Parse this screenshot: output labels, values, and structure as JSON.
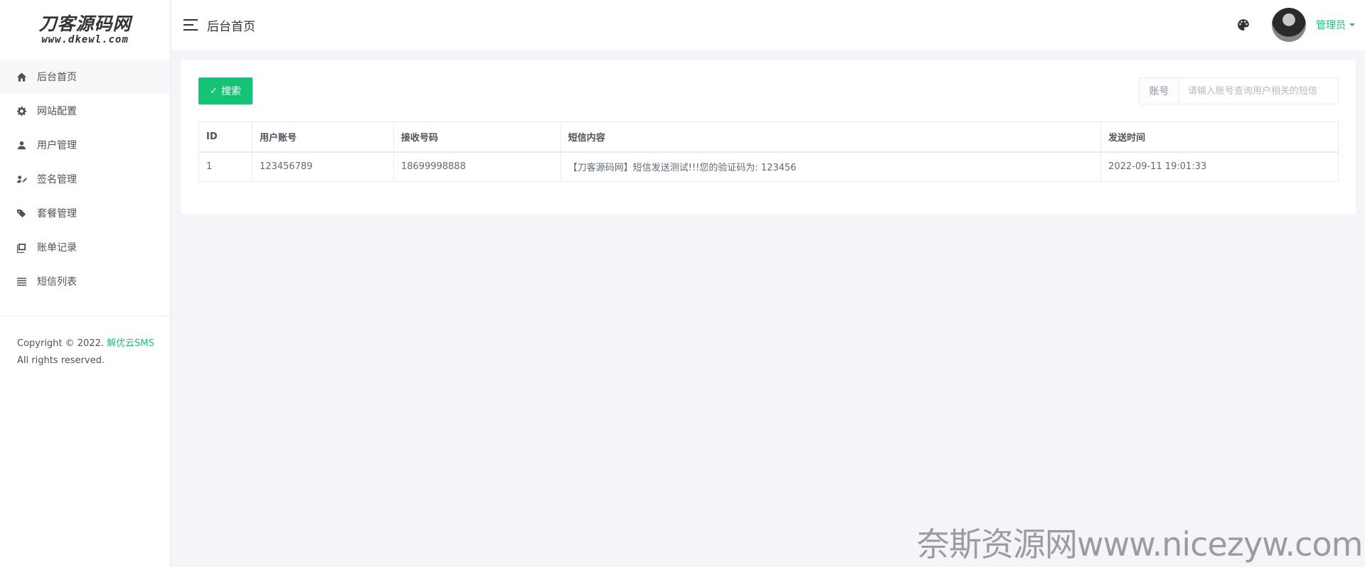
{
  "logo": {
    "title": "刀客源码网",
    "subtitle": "www.dkewl.com"
  },
  "sidebar": {
    "items": [
      {
        "label": "后台首页",
        "icon": "home-icon"
      },
      {
        "label": "网站配置",
        "icon": "gear-icon"
      },
      {
        "label": "用户管理",
        "icon": "user-icon"
      },
      {
        "label": "签名管理",
        "icon": "signature-icon"
      },
      {
        "label": "套餐管理",
        "icon": "tags-icon"
      },
      {
        "label": "账单记录",
        "icon": "book-icon"
      },
      {
        "label": "短信列表",
        "icon": "list-icon"
      }
    ],
    "copyright_prefix": "Copyright © 2022.",
    "copyright_brand": "解优云SMS",
    "copyright_suffix": "All rights reserved."
  },
  "header": {
    "title": "后台首页",
    "user_name": "管理员"
  },
  "toolbar": {
    "search_label": "搜索",
    "search_addon": "账号",
    "search_placeholder": "请输入账号查询用户相关的短信"
  },
  "table": {
    "columns": [
      "ID",
      "用户账号",
      "接收号码",
      "短信内容",
      "发送时间"
    ],
    "rows": [
      [
        "1",
        "123456789",
        "18699998888",
        "【刀客源码网】短信发送测试!!!您的验证码为: 123456",
        "2022-09-11 19:01:33"
      ]
    ]
  },
  "watermark": "奈斯资源网www.nicezyw.com",
  "colors": {
    "accent": "#15c377",
    "background": "#f3f5f8"
  }
}
